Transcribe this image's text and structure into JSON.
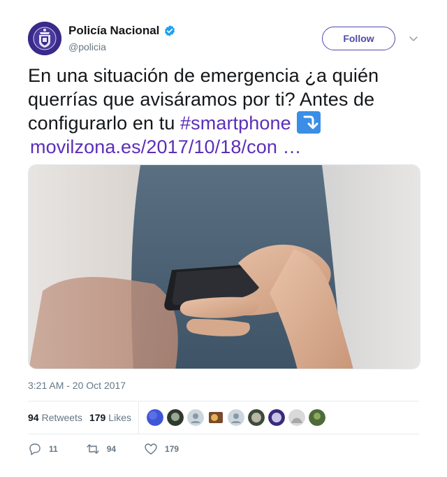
{
  "account": {
    "display_name": "Policía Nacional",
    "handle": "@policia",
    "verified": true,
    "avatar_icon": "police-crest"
  },
  "follow_label": "Follow",
  "tweet": {
    "text_part1": "En una situación de emergencia ¿a quién querrías que avisáramos por ti? Antes de configurarlo en tu ",
    "hashtag": "#smartphone",
    "emoji": "arrow-curving-down",
    "link": "movilzona.es/2017/10/18/con …"
  },
  "media": {
    "description_icon": "photo",
    "subject": "hand-holding-smartphone"
  },
  "timestamp": "3:21 AM - 20 Oct 2017",
  "stats": {
    "retweets_count": "94",
    "retweets_label": "Retweets",
    "likes_count": "179",
    "likes_label": "Likes"
  },
  "actions": {
    "reply_count": "11",
    "retweet_count": "94",
    "like_count": "179"
  },
  "colors": {
    "accent": "#4f4aa8",
    "hashtag": "#5b2fb8",
    "verified": "#1da1f2",
    "muted": "#657786"
  }
}
